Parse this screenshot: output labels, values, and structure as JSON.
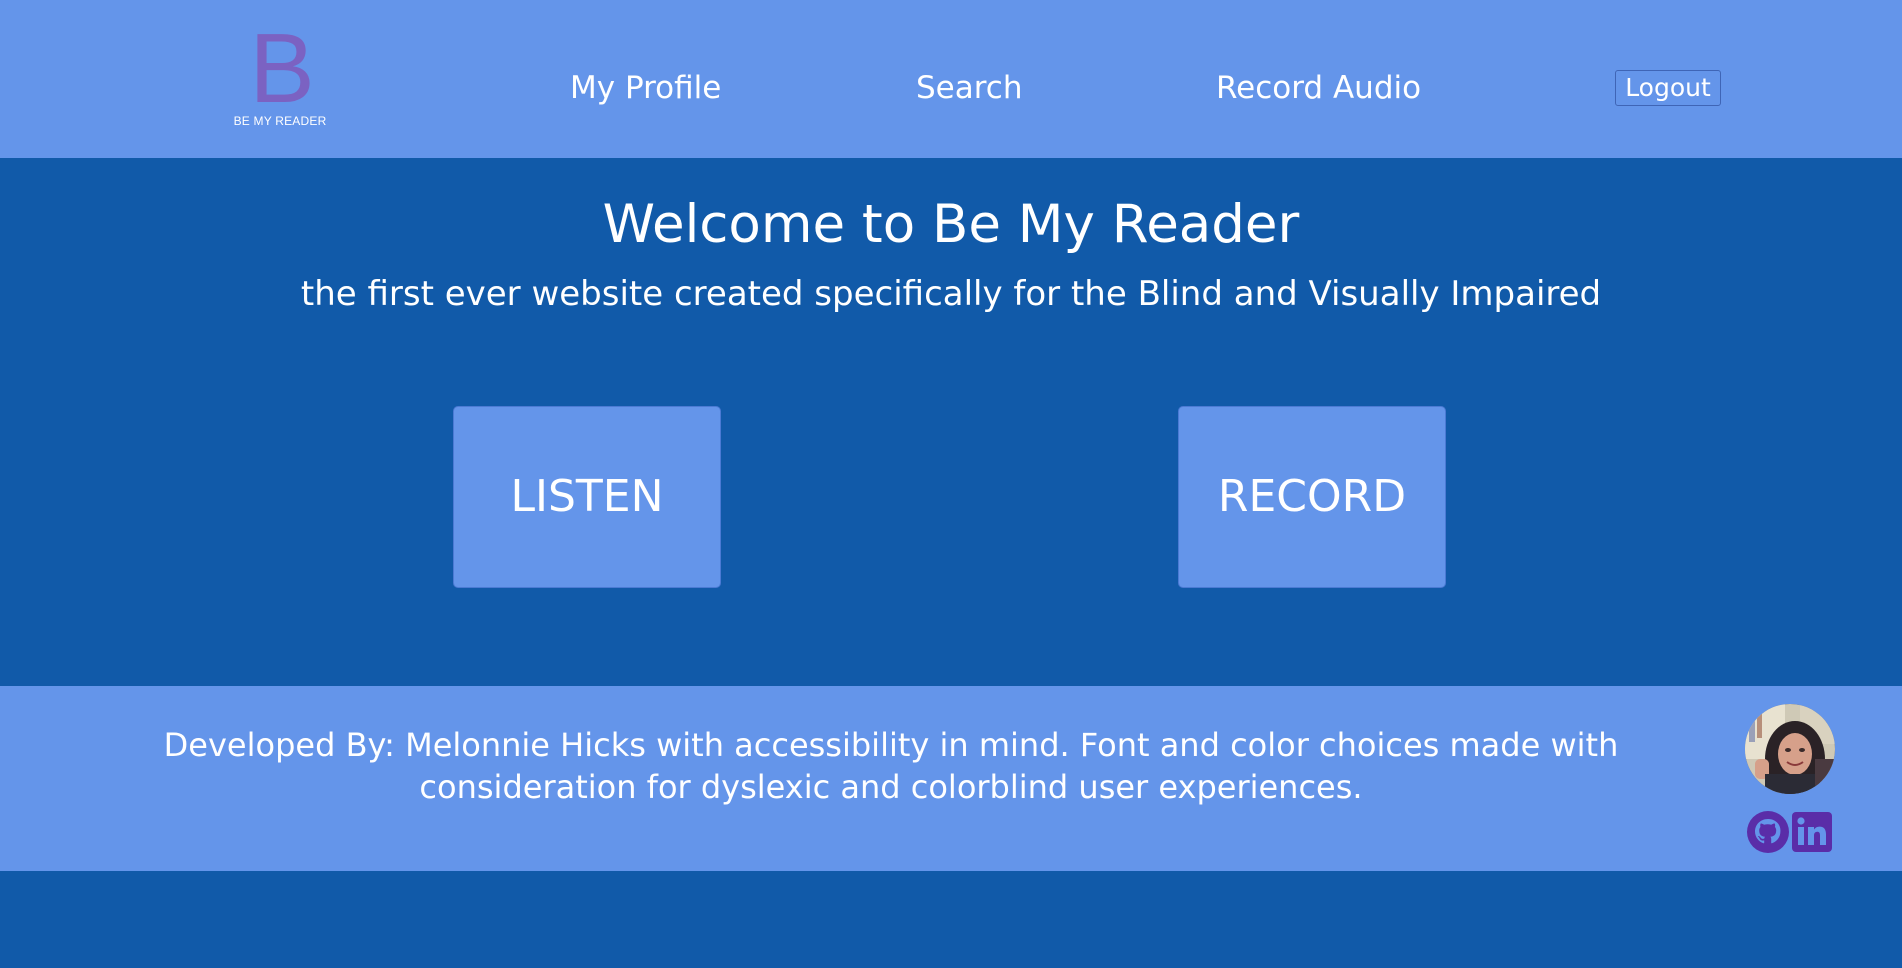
{
  "header": {
    "logo_letter": "B",
    "logo_text": "BE MY READER",
    "nav": {
      "profile": "My Profile",
      "search": "Search",
      "record_audio": "Record Audio",
      "logout": "Logout"
    }
  },
  "main": {
    "title": "Welcome to Be My Reader",
    "subtitle": "the first ever website created specifically for the Blind and Visually Impaired",
    "listen_button": "LISTEN",
    "record_button": "RECORD"
  },
  "footer": {
    "text": "Developed By: Melonnie Hicks with accessibility in mind. Font and color choices made with consideration for dyslexic and colorblind user experiences.",
    "icons": [
      "github-icon",
      "linkedin-icon"
    ]
  },
  "colors": {
    "header_bg": "#6495ea",
    "main_bg": "#115aa9",
    "logo": "#7b62c2",
    "social_icons": "#5a2da8",
    "text": "#ffffff"
  }
}
